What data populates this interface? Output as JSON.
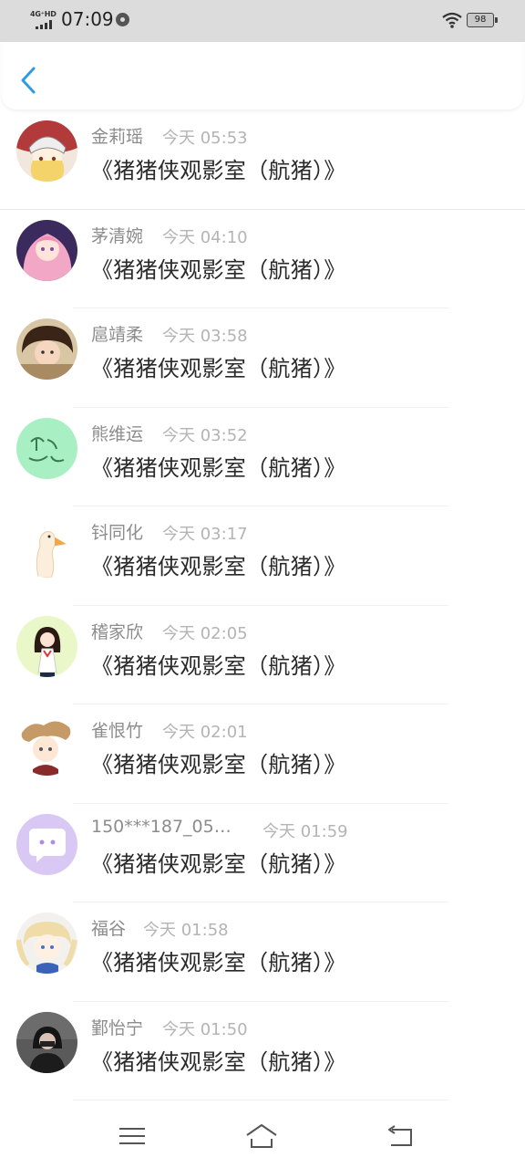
{
  "status_bar": {
    "network": "4G⁺HD",
    "time": "07:09",
    "battery": "98",
    "icons": [
      "signal-icon",
      "settings-status-icon",
      "wifi-icon",
      "battery-icon"
    ]
  },
  "header": {
    "back_icon": "chevron-left-icon",
    "accent": "#2f9be4"
  },
  "items": [
    {
      "name": "金莉瑶",
      "time": "今天 05:53",
      "title": "《猪猪侠观影室（航猪）》"
    },
    {
      "name": "茅清婉",
      "time": "今天 04:10",
      "title": "《猪猪侠观影室（航猪）》"
    },
    {
      "name": "扈靖柔",
      "time": "今天 03:58",
      "title": "《猪猪侠观影室（航猪）》"
    },
    {
      "name": "熊维运",
      "time": "今天 03:52",
      "title": "《猪猪侠观影室（航猪）》"
    },
    {
      "name": "钭同化",
      "time": "今天 03:17",
      "title": "《猪猪侠观影室（航猪）》"
    },
    {
      "name": "稽家欣",
      "time": "今天 02:05",
      "title": "《猪猪侠观影室（航猪）》"
    },
    {
      "name": "雀恨竹",
      "time": "今天 02:01",
      "title": "《猪猪侠观影室（航猪）》"
    },
    {
      "name": "150***187_05…",
      "time": "今天 01:59",
      "title": "《猪猪侠观影室（航猪）》"
    },
    {
      "name": "福谷",
      "time": "今天 01:58",
      "title": "《猪猪侠观影室（航猪）》"
    },
    {
      "name": "鄞怡宁",
      "time": "今天 01:50",
      "title": "《猪猪侠观影室（航猪）》"
    }
  ],
  "nav_bar": {
    "icons": [
      "menu-icon",
      "home-icon",
      "back-icon"
    ]
  }
}
